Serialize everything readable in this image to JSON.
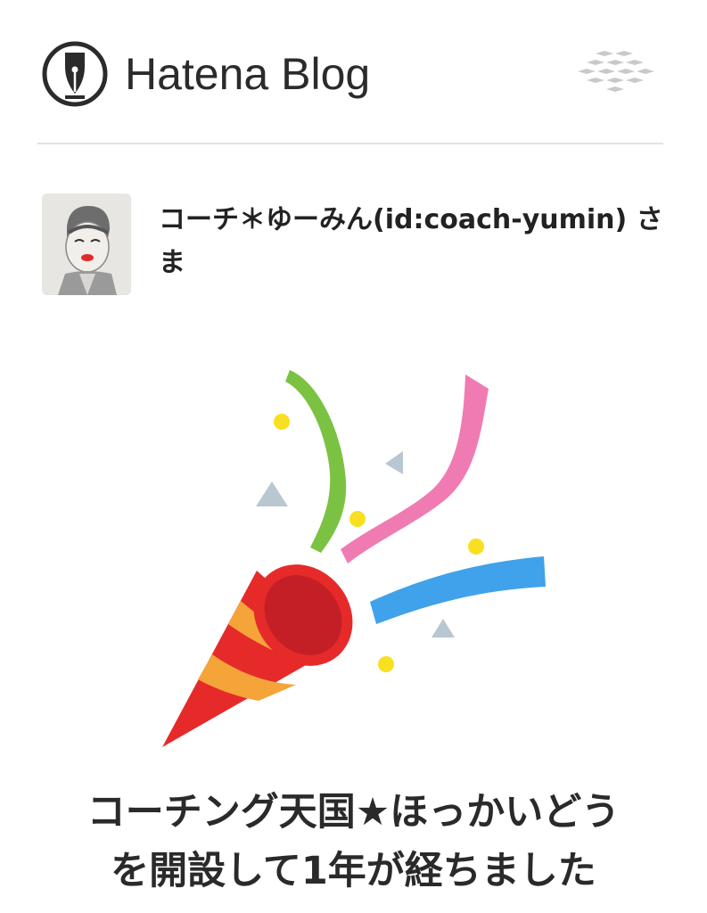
{
  "header": {
    "logo_text": "Hatena Blog",
    "logo_icon": "pen-nib-icon",
    "menu_icon": "service-menu-icon"
  },
  "user": {
    "name_line": "コーチ＊ゆーみん(id:coach-yumin) さま",
    "avatar": "user-avatar-illustration"
  },
  "illustration": "party-popper",
  "message": {
    "line1": "コーチング天国★ほっかいどう",
    "line2": "を開設して1年が経ちました"
  },
  "colors": {
    "popper_red": "#e62a2a",
    "popper_stripe": "#f5a43a",
    "ribbon_green": "#7cc242",
    "ribbon_pink": "#f07bb3",
    "ribbon_blue": "#3fa2ea",
    "confetti_yellow": "#f8e020",
    "confetti_gray": "#b9c7d1"
  }
}
